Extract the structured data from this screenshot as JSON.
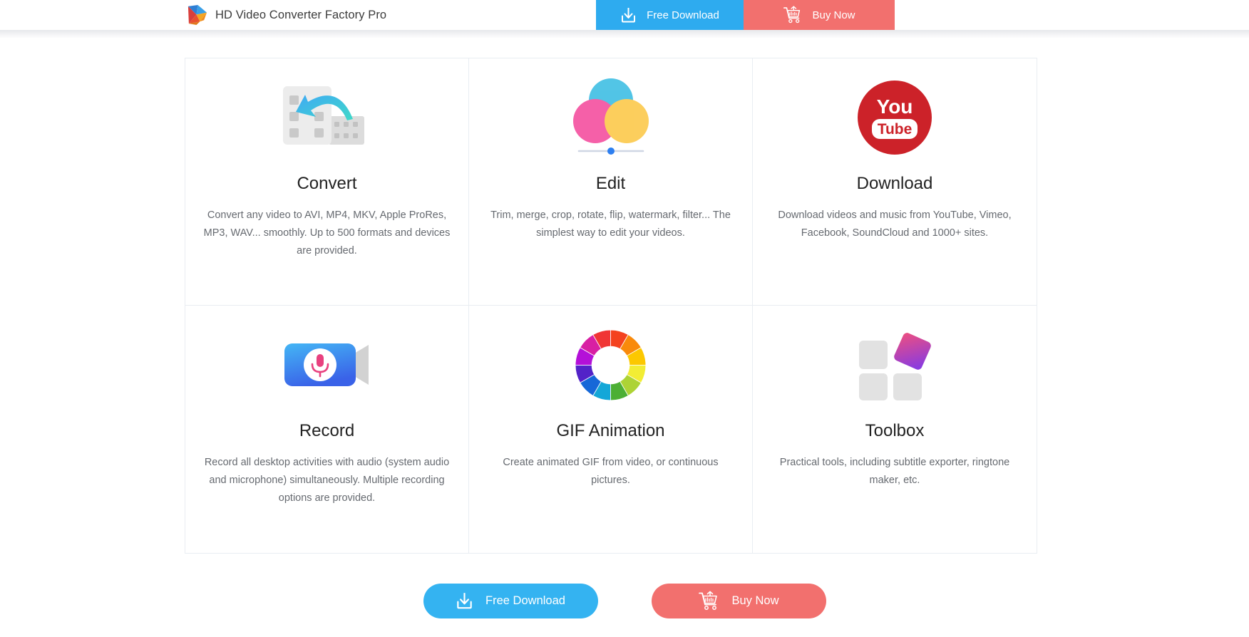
{
  "header": {
    "brand_title": "HD Video Converter Factory Pro",
    "logo_icon": "app-logo-play-triangle",
    "free_download_label": "Free Download",
    "free_download_icon": "download-arrow-icon",
    "buy_now_label": "Buy Now",
    "buy_now_icon": "shopping-cart-icon",
    "free_download_color": "#2eabef",
    "buy_now_color": "#f2706e"
  },
  "cards": [
    {
      "title": "Convert",
      "desc": "Convert any video to AVI, MP4, MKV, Apple ProRes, MP3, WAV... smoothly. Up to 500 formats and devices are provided.",
      "icon": "convert-film-arrow-icon"
    },
    {
      "title": "Edit",
      "desc": "Trim, merge, crop, rotate, flip, watermark, filter... The simplest way to edit your videos.",
      "icon": "edit-color-circles-slider-icon"
    },
    {
      "title": "Download",
      "desc": "Download videos and music from YouTube, Vimeo, Facebook, SoundCloud and 1000+ sites.",
      "icon": "youtube-logo-icon",
      "youtube_you": "You",
      "youtube_tube": "Tube"
    },
    {
      "title": "Record",
      "desc": "Record all desktop activities with audio (system audio and microphone) simultaneously. Multiple recording options are provided.",
      "icon": "record-microphone-camera-icon"
    },
    {
      "title": "GIF Animation",
      "desc": "Create animated GIF from video, or continuous pictures.",
      "icon": "color-wheel-icon"
    },
    {
      "title": "Toolbox",
      "desc": "Practical tools, including subtitle exporter, ringtone maker, etc.",
      "icon": "toolbox-squares-icon"
    }
  ],
  "cta": {
    "free_download_label": "Free Download",
    "free_download_icon": "download-arrow-icon",
    "buy_now_label": "Buy Now",
    "buy_now_icon": "shopping-cart-icon"
  }
}
